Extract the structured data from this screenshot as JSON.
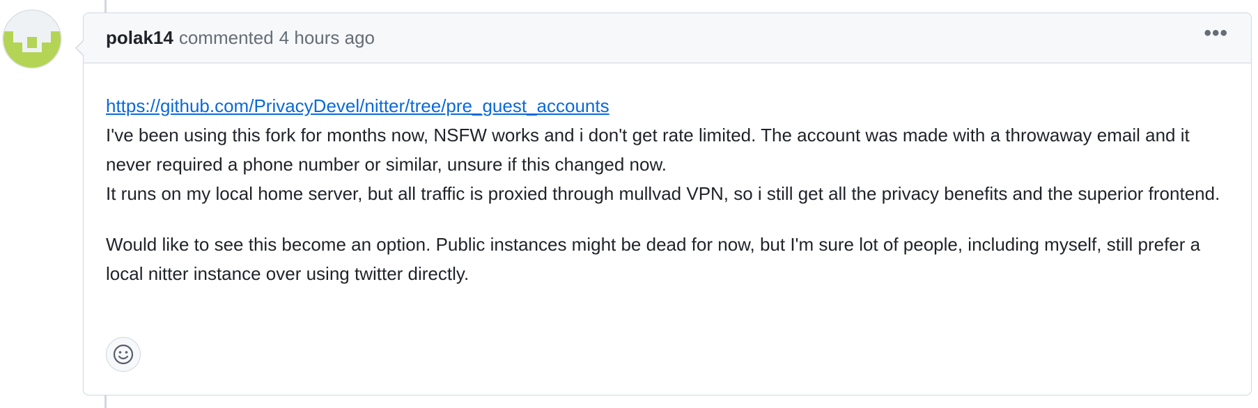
{
  "comment": {
    "author": "polak14",
    "action": "commented",
    "timestamp": "4 hours ago",
    "menu_icon": "kebab-horizontal-icon",
    "body": {
      "link_text": "https://github.com/PrivacyDevel/nitter/tree/pre_guest_accounts",
      "line1": "I've been using this fork for months now, NSFW works and i don't get rate limited. The account was made with a throwaway email and it never required a phone number or similar, unsure if this changed now.",
      "line2": "It runs on my local home server, but all traffic is proxied through mullvad VPN, so i still get all the privacy benefits and the superior frontend.",
      "paragraph2": "Would like to see this become an option. Public instances might be dead for now, but I'm sure lot of people, including myself, still prefer a local nitter instance over using twitter directly."
    },
    "reaction_icon": "smiley-icon"
  },
  "colors": {
    "avatar_pattern": "#b4d455",
    "link": "#0969da",
    "header_bg": "#f6f8fa",
    "border": "#d0d7de"
  }
}
